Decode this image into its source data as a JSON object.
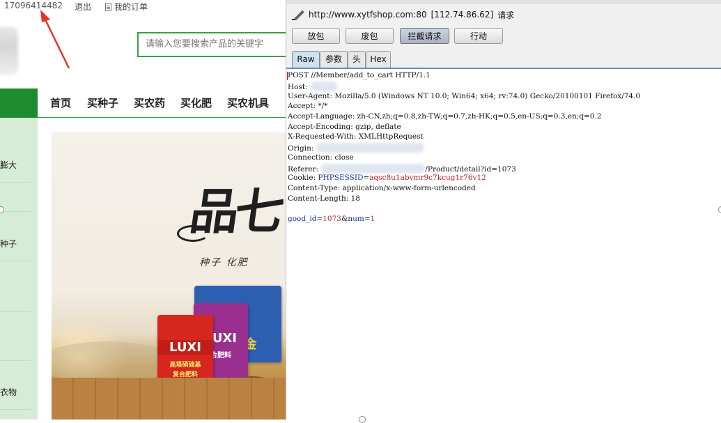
{
  "shop": {
    "phone": "17096414482",
    "logout": "退出",
    "orders": "我的订单",
    "search_placeholder": "请输入您要搜索产品的关键字",
    "nav": [
      "首页",
      "买种子",
      "买农药",
      "买化肥",
      "买农机具"
    ],
    "side_items": [
      "膨大",
      "种子",
      "衣物"
    ],
    "banner": {
      "subtitle": "种子   化肥",
      "bag1": "LUXI",
      "bag1_sub": "高塔硝硫基",
      "bag1_sub2": "复合肥料",
      "bag2": "LUXI",
      "bag2_sub": "合肥料",
      "bag3": "麦黄金"
    }
  },
  "burp": {
    "url": "http://www.xytfshop.com:80",
    "ip": "[112.74.86.62]",
    "request_label": "请求",
    "buttons": [
      "放包",
      "废包",
      "拦截请求",
      "行动"
    ],
    "active_button": 2,
    "tabs": [
      "Raw",
      "参数",
      "头",
      "Hex"
    ],
    "request_line": "POST //Member/add_to_cart HTTP/1.1",
    "host_label": "Host:",
    "user_agent_label": "User-Agent:",
    "user_agent_value": "Mozilla/5.0 (Windows NT 10.0; Win64; x64; rv:74.0) Gecko/20100101 Firefox/74.0",
    "accept": "Accept: */*",
    "accept_language": "Accept-Language: zh-CN,zh;q=0.8,zh-TW;q=0.7,zh-HK;q=0.5,en-US;q=0.3,en;q=0.2",
    "accept_encoding": "Accept-Encoding: gzip, deflate",
    "x_requested_with": "X-Requested-With: XMLHttpRequest",
    "origin_label": "Origin:",
    "connection": "Connection: close",
    "referer_label": "Referer:",
    "referer_value": "/Product/detail?id=1073",
    "cookie_label": "Cookie:",
    "cookie_name": "PHPSESSID",
    "cookie_value": "aqsc8u1abvmr9c7kcug1r76v12",
    "content_type": "Content-Type: application/x-www-form-urlencoded",
    "content_length": "Content-Length: 18",
    "body_key1": "good_id",
    "body_val1": "1073",
    "body_key2": "num",
    "body_val2": "1"
  }
}
